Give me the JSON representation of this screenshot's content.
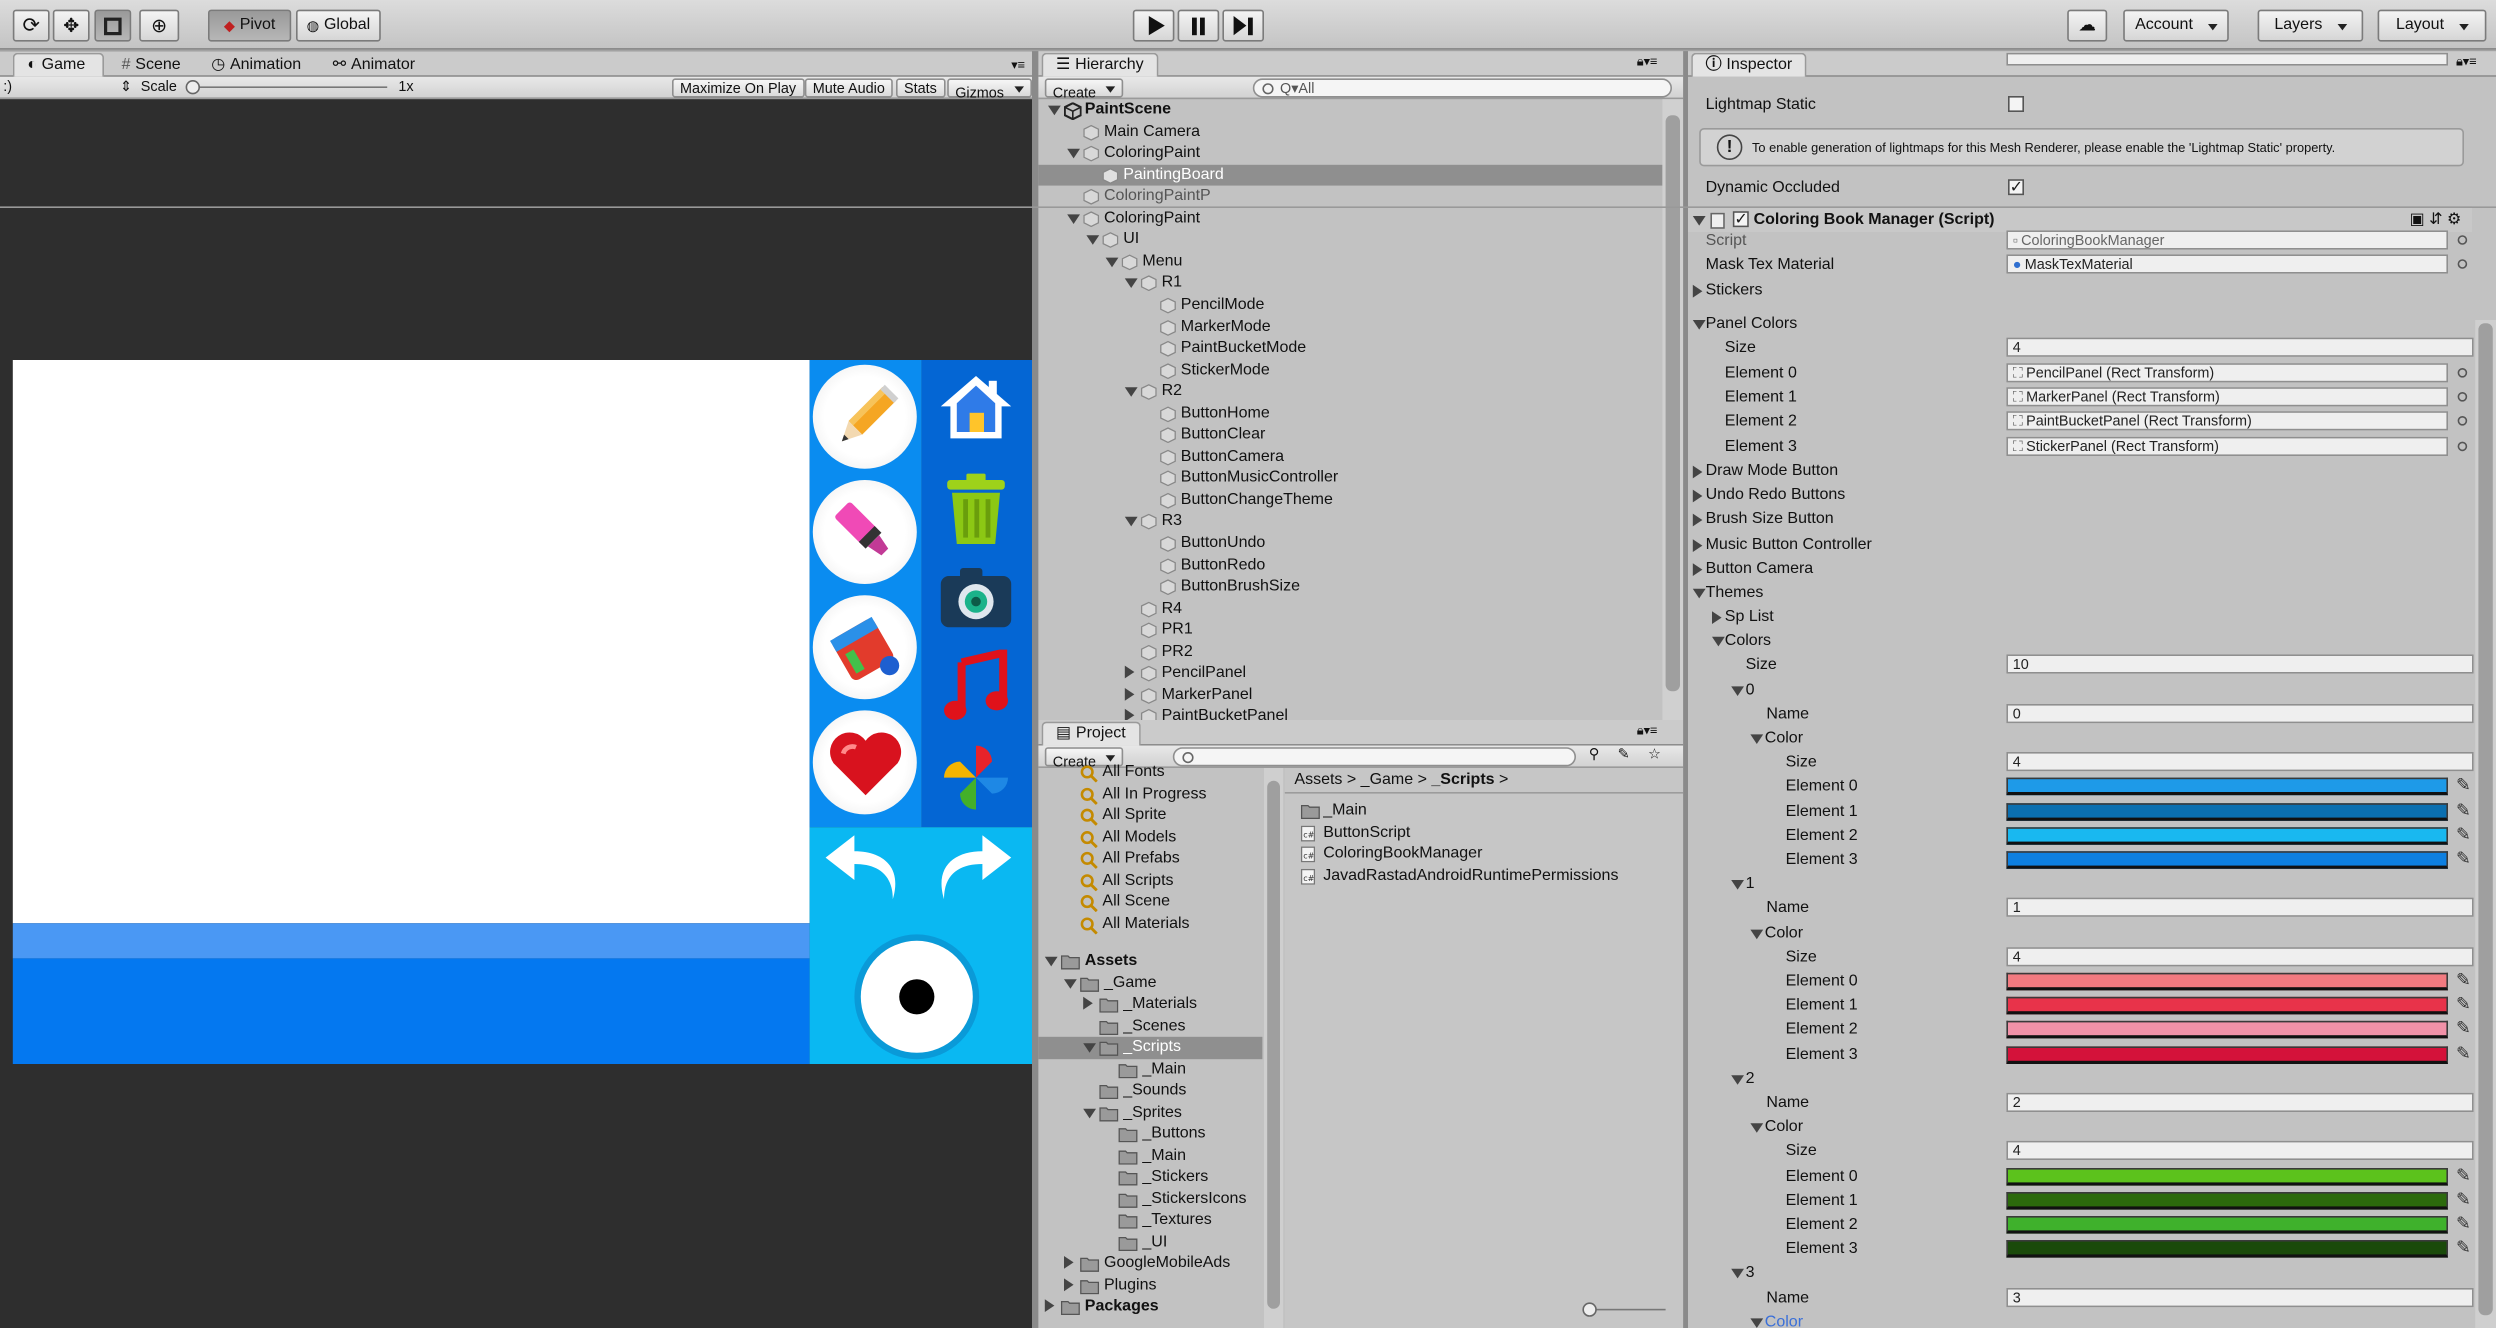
{
  "toolbar": {
    "pivot": "Pivot",
    "global": "Global",
    "account": "Account",
    "layers": "Layers",
    "layout": "Layout"
  },
  "game": {
    "tabs": [
      "Game",
      "Scene",
      "Animation",
      "Animator"
    ],
    "display_prefix": ":)",
    "scale_label": "Scale",
    "scale_value": "1x",
    "buttons": [
      "Maximize On Play",
      "Mute Audio",
      "Stats",
      "Gizmos"
    ]
  },
  "hierarchy": {
    "tab": "Hierarchy",
    "create": "Create",
    "search": "Q▾All",
    "rows": [
      {
        "label": "PaintScene",
        "indent": 0,
        "arrow": "down",
        "icon": "unity",
        "bold": true
      },
      {
        "label": "Main Camera",
        "indent": 1,
        "arrow": "",
        "icon": "cube"
      },
      {
        "label": "ColoringPaint",
        "indent": 1,
        "arrow": "down",
        "icon": "cube"
      },
      {
        "label": "PaintingBoard",
        "indent": 2,
        "arrow": "",
        "icon": "cube",
        "selected": true
      },
      {
        "label": "ColoringPaintP",
        "indent": 1,
        "arrow": "",
        "icon": "cube",
        "dim": true
      },
      {
        "label": "ColoringPaint",
        "indent": 1,
        "arrow": "down",
        "icon": "cube"
      },
      {
        "label": "UI",
        "indent": 2,
        "arrow": "down",
        "icon": "cube"
      },
      {
        "label": "Menu",
        "indent": 3,
        "arrow": "down",
        "icon": "cube"
      },
      {
        "label": "R1",
        "indent": 4,
        "arrow": "down",
        "icon": "cube"
      },
      {
        "label": "PencilMode",
        "indent": 5,
        "arrow": "",
        "icon": "cube"
      },
      {
        "label": "MarkerMode",
        "indent": 5,
        "arrow": "",
        "icon": "cube"
      },
      {
        "label": "PaintBucketMode",
        "indent": 5,
        "arrow": "",
        "icon": "cube"
      },
      {
        "label": "StickerMode",
        "indent": 5,
        "arrow": "",
        "icon": "cube"
      },
      {
        "label": "R2",
        "indent": 4,
        "arrow": "down",
        "icon": "cube"
      },
      {
        "label": "ButtonHome",
        "indent": 5,
        "arrow": "",
        "icon": "cube"
      },
      {
        "label": "ButtonClear",
        "indent": 5,
        "arrow": "",
        "icon": "cube"
      },
      {
        "label": "ButtonCamera",
        "indent": 5,
        "arrow": "",
        "icon": "cube"
      },
      {
        "label": "ButtonMusicController",
        "indent": 5,
        "arrow": "",
        "icon": "cube"
      },
      {
        "label": "ButtonChangeTheme",
        "indent": 5,
        "arrow": "",
        "icon": "cube"
      },
      {
        "label": "R3",
        "indent": 4,
        "arrow": "down",
        "icon": "cube"
      },
      {
        "label": "ButtonUndo",
        "indent": 5,
        "arrow": "",
        "icon": "cube"
      },
      {
        "label": "ButtonRedo",
        "indent": 5,
        "arrow": "",
        "icon": "cube"
      },
      {
        "label": "ButtonBrushSize",
        "indent": 5,
        "arrow": "",
        "icon": "cube"
      },
      {
        "label": "R4",
        "indent": 4,
        "arrow": "",
        "icon": "cube"
      },
      {
        "label": "PR1",
        "indent": 4,
        "arrow": "",
        "icon": "cube"
      },
      {
        "label": "PR2",
        "indent": 4,
        "arrow": "",
        "icon": "cube"
      },
      {
        "label": "PencilPanel",
        "indent": 4,
        "arrow": "right",
        "icon": "cube"
      },
      {
        "label": "MarkerPanel",
        "indent": 4,
        "arrow": "right",
        "icon": "cube"
      },
      {
        "label": "PaintBucketPanel",
        "indent": 4,
        "arrow": "right",
        "icon": "cube"
      }
    ]
  },
  "project": {
    "tab": "Project",
    "create": "Create",
    "favorites": [
      "All Fonts",
      "All In Progress",
      "All Sprite",
      "All Models",
      "All Prefabs",
      "All Scripts",
      "All Scene",
      "All Materials"
    ],
    "tree": [
      {
        "label": "Assets",
        "indent": 0,
        "arrow": "down",
        "bold": true
      },
      {
        "label": "_Game",
        "indent": 1,
        "arrow": "down"
      },
      {
        "label": "_Materials",
        "indent": 2,
        "arrow": "right"
      },
      {
        "label": "_Scenes",
        "indent": 2,
        "arrow": ""
      },
      {
        "label": "_Scripts",
        "indent": 2,
        "arrow": "down",
        "selected": true
      },
      {
        "label": "_Main",
        "indent": 3,
        "arrow": ""
      },
      {
        "label": "_Sounds",
        "indent": 2,
        "arrow": ""
      },
      {
        "label": "_Sprites",
        "indent": 2,
        "arrow": "down"
      },
      {
        "label": "_Buttons",
        "indent": 3,
        "arrow": ""
      },
      {
        "label": "_Main",
        "indent": 3,
        "arrow": ""
      },
      {
        "label": "_Stickers",
        "indent": 3,
        "arrow": ""
      },
      {
        "label": "_StickersIcons",
        "indent": 3,
        "arrow": ""
      },
      {
        "label": "_Textures",
        "indent": 3,
        "arrow": ""
      },
      {
        "label": "_UI",
        "indent": 3,
        "arrow": ""
      },
      {
        "label": "GoogleMobileAds",
        "indent": 1,
        "arrow": "right"
      },
      {
        "label": "Plugins",
        "indent": 1,
        "arrow": "right"
      },
      {
        "label": "Packages",
        "indent": 0,
        "arrow": "right",
        "bold": true
      }
    ],
    "breadcrumb": [
      "Assets",
      "_Game",
      "_Scripts"
    ],
    "files": [
      {
        "label": "_Main",
        "type": "folder"
      },
      {
        "label": "ButtonScript",
        "type": "script"
      },
      {
        "label": "ColoringBookManager",
        "type": "script"
      },
      {
        "label": "JavadRastadAndroidRuntimePermissions",
        "type": "script"
      }
    ]
  },
  "inspector": {
    "tab": "Inspector",
    "lightmap_static": "Lightmap Static",
    "info_text": "To enable generation of lightmaps for this Mesh Renderer, please enable the 'Lightmap Static' property.",
    "dynamic_occluded": "Dynamic Occluded",
    "component_title": "Coloring Book Manager (Script)",
    "script_label": "Script",
    "script_value": "ColoringBookManager",
    "mask_label": "Mask Tex Material",
    "mask_value": "MaskTexMaterial",
    "stickers": "Stickers",
    "panel_colors": "Panel Colors",
    "size_label": "Size",
    "panel_size": "4",
    "panel_elements": [
      {
        "label": "Element 0",
        "value": "PencilPanel (Rect Transform)"
      },
      {
        "label": "Element 1",
        "value": "MarkerPanel (Rect Transform)"
      },
      {
        "label": "Element 2",
        "value": "PaintBucketPanel (Rect Transform)"
      },
      {
        "label": "Element 3",
        "value": "StickerPanel (Rect Transform)"
      }
    ],
    "collapsed": [
      "Draw Mode Button",
      "Undo Redo Buttons",
      "Brush Size Button",
      "Music Button Controller",
      "Button Camera"
    ],
    "themes": "Themes",
    "sp_list": "Sp List",
    "colors": "Colors",
    "colors_size": "10",
    "name_label": "Name",
    "color_label": "Color",
    "theme_groups": [
      {
        "index": "0",
        "name": "0",
        "size": "4",
        "swatches": [
          "#1e9ae8",
          "#0b6fb0",
          "#19b8f0",
          "#0d7fe0"
        ]
      },
      {
        "index": "1",
        "name": "1",
        "size": "4",
        "swatches": [
          "#f27a80",
          "#e8334a",
          "#f291a8",
          "#d4123a"
        ]
      },
      {
        "index": "2",
        "name": "2",
        "size": "4",
        "swatches": [
          "#5cc21c",
          "#2c6a0c",
          "#3fb12c",
          "#1a4a0a"
        ]
      },
      {
        "index": "3",
        "name": "3"
      }
    ],
    "element_labels": [
      "Element 0",
      "Element 1",
      "Element 2",
      "Element 3"
    ]
  },
  "colors": {
    "game_sky": "#0ab8f2",
    "game_blue_dark": "#0478f0",
    "game_blue_light": "#4a98f4",
    "selection": "#8f8f8f"
  }
}
